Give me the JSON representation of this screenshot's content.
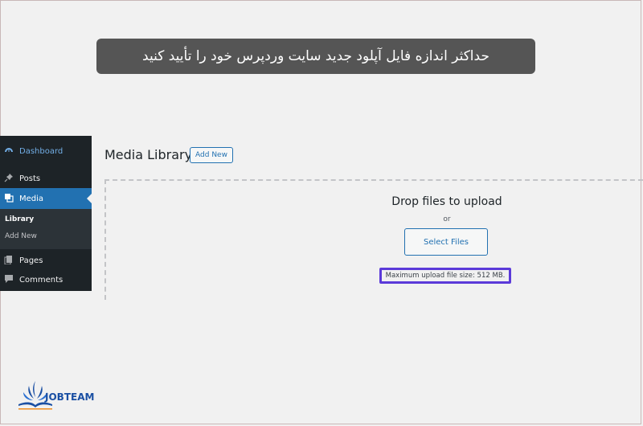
{
  "banner": {
    "text": "حداکثر اندازه فایل آپلود جدید سایت وردپرس خود را تأیید کنید"
  },
  "sidebar": {
    "items": [
      {
        "label": "Dashboard",
        "icon": "dashboard-icon"
      },
      {
        "label": "Posts",
        "icon": "pin-icon"
      },
      {
        "label": "Media",
        "icon": "media-icon"
      },
      {
        "label": "Pages",
        "icon": "pages-icon"
      },
      {
        "label": "Comments",
        "icon": "comment-icon"
      }
    ],
    "submenu": [
      {
        "label": "Library"
      },
      {
        "label": "Add New"
      }
    ]
  },
  "main": {
    "title": "Media Library",
    "add_new_label": "Add New",
    "drop_title": "Drop files to upload",
    "or_text": "or",
    "select_files_label": "Select Files",
    "max_upload_text": "Maximum upload file size: 512 MB."
  },
  "logo": {
    "text": "JOBTEAM"
  },
  "colors": {
    "sidebar_bg": "#1d2327",
    "active_bg": "#2271b1",
    "highlight": "#5b3ad9",
    "banner_bg": "#555555"
  }
}
